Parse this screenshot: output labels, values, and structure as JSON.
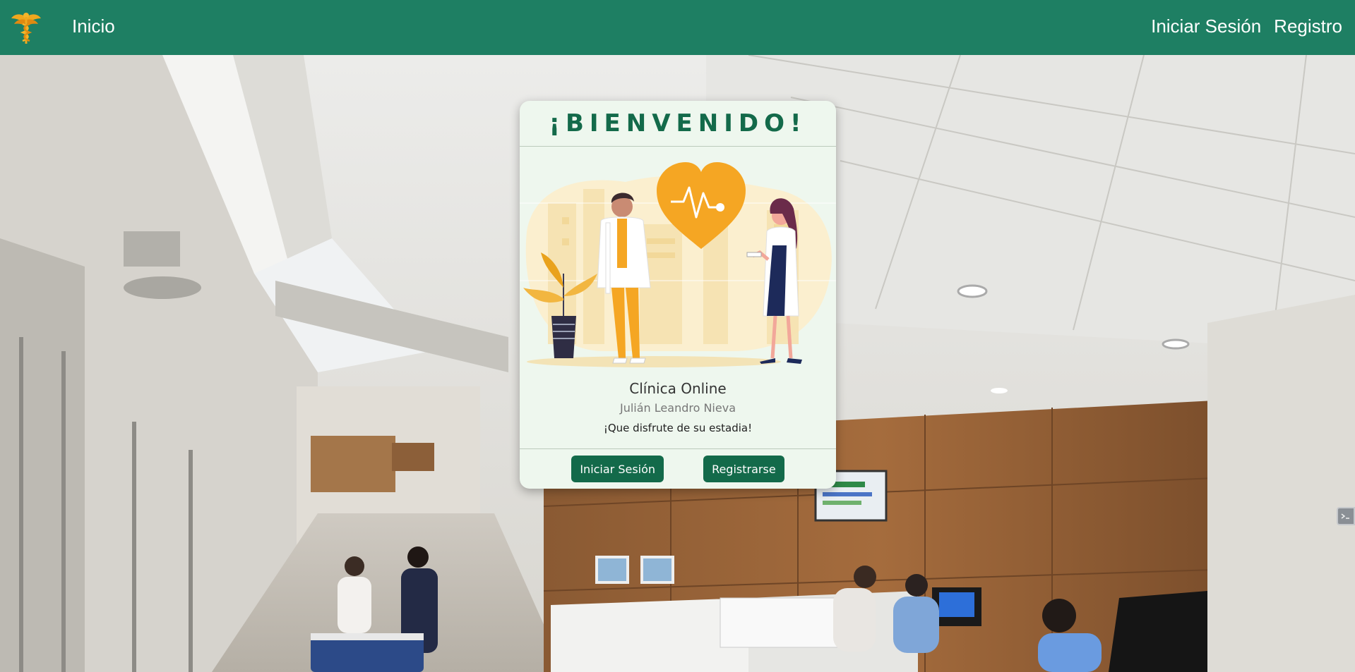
{
  "navbar": {
    "logo_icon": "caduceus-icon",
    "home_label": "Inicio",
    "login_label": "Iniciar Sesión",
    "register_label": "Registro",
    "color": "#1e7f63"
  },
  "card": {
    "title": "¡BIENVENIDO!",
    "illustration": "doctors-heart-illustration",
    "clinic_name": "Clínica Online",
    "author": "Julián Leandro Nieva",
    "message": "¡Que disfrute de su estadia!",
    "login_button": "Iniciar Sesión",
    "register_button": "Registrarse",
    "accent": "#136a4a",
    "background": "#eef7ee"
  },
  "background_image": "hospital-hallway-photo",
  "side_widget_icon": "terminal-icon"
}
